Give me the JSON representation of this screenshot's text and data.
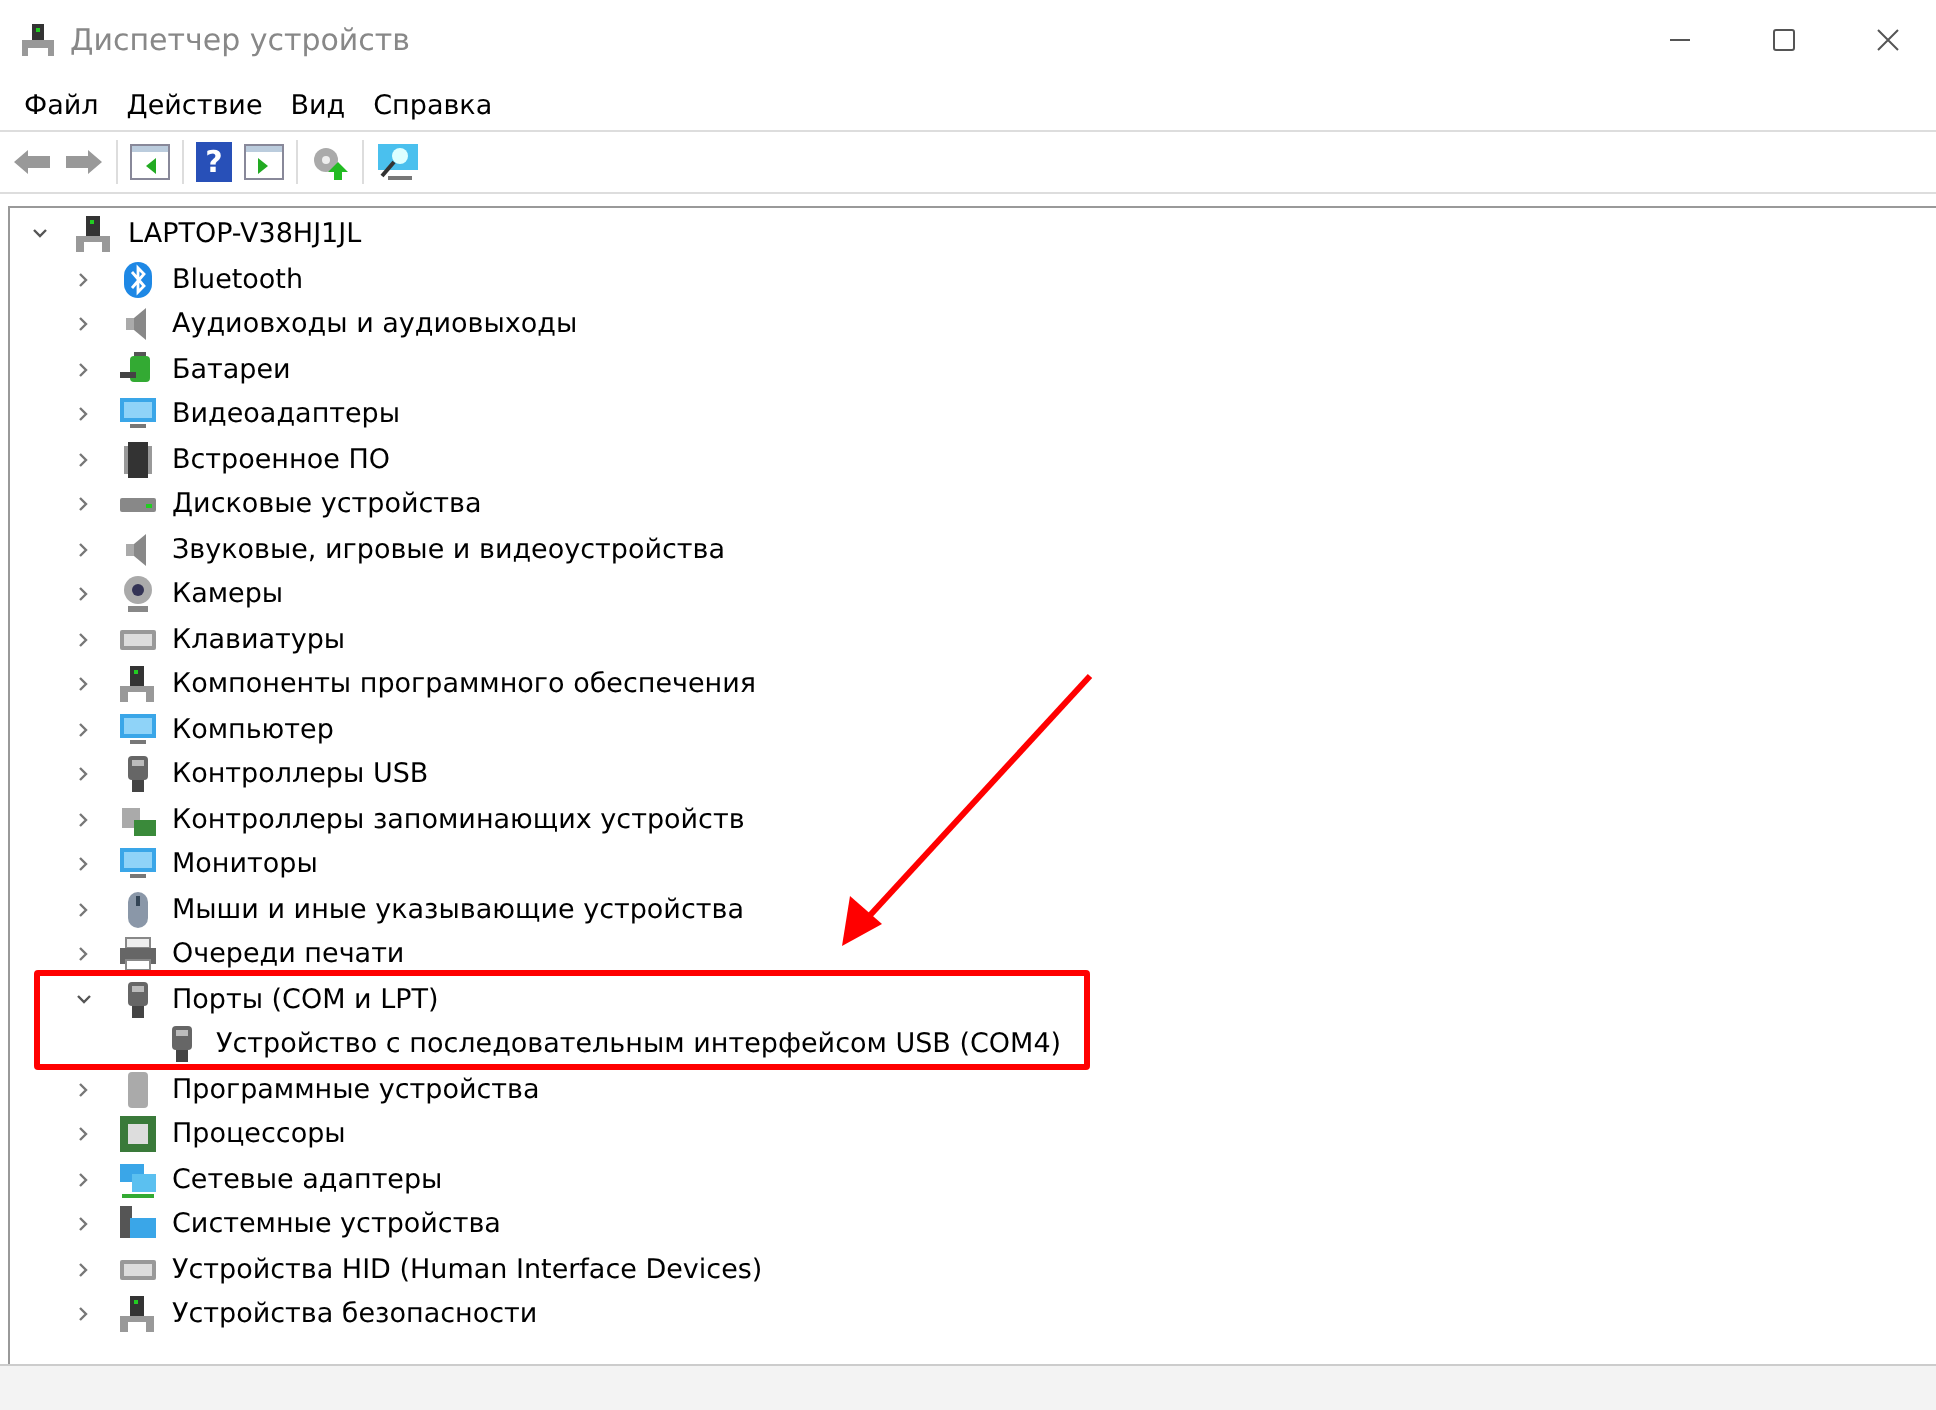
{
  "window": {
    "title": "Диспетчер устройств"
  },
  "menu": [
    "Файл",
    "Действие",
    "Вид",
    "Справка"
  ],
  "toolbar": {
    "help_glyph": "?"
  },
  "tree": [
    {
      "label": "LAPTOP-V38HJ1JL",
      "expanded": true,
      "children": [
        {
          "label": "Bluetooth",
          "expanded": false
        },
        {
          "label": "Аудиовходы и аудиовыходы",
          "expanded": false
        },
        {
          "label": "Батареи",
          "expanded": false
        },
        {
          "label": "Видеоадаптеры",
          "expanded": false
        },
        {
          "label": "Встроенное ПО",
          "expanded": false
        },
        {
          "label": "Дисковые устройства",
          "expanded": false
        },
        {
          "label": "Звуковые, игровые и видеоустройства",
          "expanded": false
        },
        {
          "label": "Камеры",
          "expanded": false
        },
        {
          "label": "Клавиатуры",
          "expanded": false
        },
        {
          "label": "Компоненты программного обеспечения",
          "expanded": false
        },
        {
          "label": "Компьютер",
          "expanded": false
        },
        {
          "label": "Контроллеры USB",
          "expanded": false
        },
        {
          "label": "Контроллеры запоминающих устройств",
          "expanded": false
        },
        {
          "label": "Мониторы",
          "expanded": false
        },
        {
          "label": "Мыши и иные указывающие устройства",
          "expanded": false
        },
        {
          "label": "Очереди печати",
          "expanded": false
        },
        {
          "label": "Порты (COM и LPT)",
          "expanded": true,
          "children": [
            {
              "label": "Устройство с последовательным интерфейсом USB (COM4)"
            }
          ]
        },
        {
          "label": "Программные устройства",
          "expanded": false
        },
        {
          "label": "Процессоры",
          "expanded": false
        },
        {
          "label": "Сетевые адаптеры",
          "expanded": false
        },
        {
          "label": "Системные устройства",
          "expanded": false
        },
        {
          "label": "Устройства HID (Human Interface Devices)",
          "expanded": false
        },
        {
          "label": "Устройства безопасности",
          "expanded": false
        }
      ]
    }
  ]
}
